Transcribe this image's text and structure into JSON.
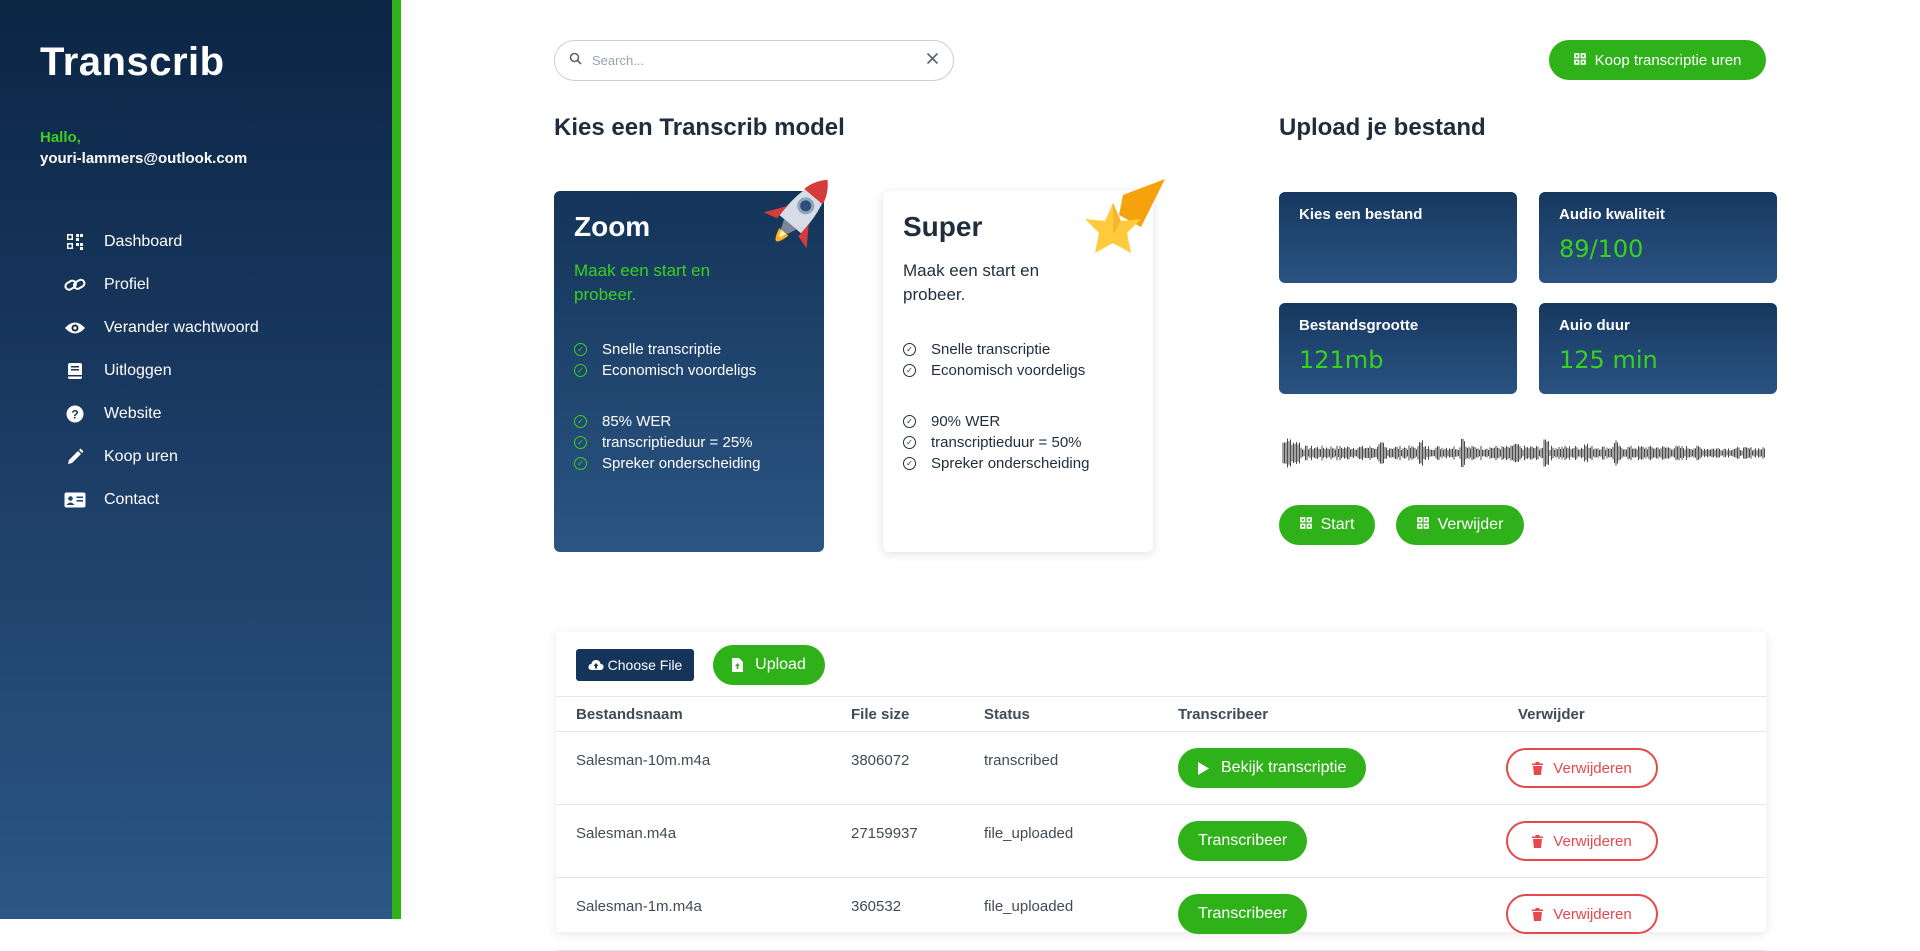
{
  "sidebar": {
    "brand": "Transcrib",
    "greeting": "Hallo,",
    "email": "youri-lammers@outlook.com",
    "items": [
      {
        "label": "Dashboard",
        "icon": "dashboard-icon"
      },
      {
        "label": "Profiel",
        "icon": "link-icon"
      },
      {
        "label": "Verander wachtwoord",
        "icon": "eye-icon"
      },
      {
        "label": "Uitloggen",
        "icon": "book-icon"
      },
      {
        "label": "Website",
        "icon": "help-icon"
      },
      {
        "label": "Koop uren",
        "icon": "pencil-icon"
      },
      {
        "label": "Contact",
        "icon": "contact-card-icon"
      }
    ]
  },
  "search": {
    "placeholder": "Search..."
  },
  "header": {
    "buy_label": "Koop transcriptie uren"
  },
  "models": {
    "title": "Kies een Transcrib model",
    "zoom": {
      "name": "Zoom",
      "tagline": "Maak een start en probeer.",
      "features_a": [
        "Snelle transcriptie",
        "Economisch voordeligs"
      ],
      "features_b": [
        "85% WER",
        "transcriptieduur = 25%",
        "Spreker onderscheiding"
      ]
    },
    "super": {
      "name": "Super",
      "tagline": "Maak een start en probeer.",
      "features_a": [
        "Snelle transcriptie",
        "Economisch voordeligs"
      ],
      "features_b": [
        "90% WER",
        "transcriptieduur = 50%",
        "Spreker onderscheiding"
      ]
    }
  },
  "upload": {
    "title": "Upload je bestand",
    "choose_file": {
      "label": "Kies een bestand",
      "value": ""
    },
    "quality": {
      "label": "Audio kwaliteit",
      "value": "89/100"
    },
    "size": {
      "label": "Bestandsgrootte",
      "value": "121mb"
    },
    "duration": {
      "label": "Auio duur",
      "value": "125 min"
    },
    "start_label": "Start",
    "remove_label": "Verwijder"
  },
  "table": {
    "choose_file_label": "Choose File",
    "upload_label": "Upload",
    "headers": [
      "Bestandsnaam",
      "File size",
      "Status",
      "Transcribeer",
      "Verwijder"
    ],
    "rows": [
      {
        "name": "Salesman-10m.m4a",
        "size": "3806072",
        "status": "transcribed",
        "action": "Bekijk transcriptie",
        "delete": "Verwijderen"
      },
      {
        "name": "Salesman.m4a",
        "size": "27159937",
        "status": "file_uploaded",
        "action": "Transcribeer",
        "delete": "Verwijderen"
      },
      {
        "name": "Salesman-1m.m4a",
        "size": "360532",
        "status": "file_uploaded",
        "action": "Transcribeer",
        "delete": "Verwijderen"
      }
    ]
  },
  "colors": {
    "accent": "#2fb11a",
    "navy": "#143459",
    "danger": "#e5484d"
  }
}
